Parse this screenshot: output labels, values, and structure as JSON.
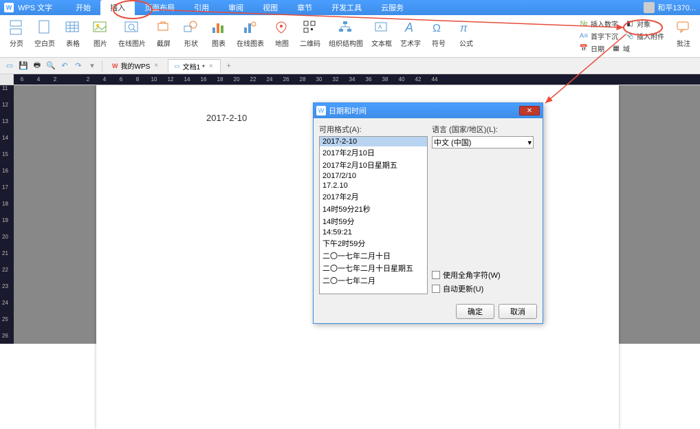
{
  "app_name": "WPS 文字",
  "user_name": "和平1370...",
  "menu_tabs": [
    "开始",
    "插入",
    "页面布局",
    "引用",
    "审阅",
    "视图",
    "章节",
    "开发工具",
    "云服务"
  ],
  "active_tab": "插入",
  "ribbon_tools": [
    {
      "label": "分页",
      "dropdown": true
    },
    {
      "label": "空白页",
      "dropdown": true
    },
    {
      "label": "表格",
      "dropdown": true
    },
    {
      "label": "图片",
      "dropdown": true
    },
    {
      "label": "在线图片"
    },
    {
      "label": "截屏",
      "dropdown": true
    },
    {
      "label": "形状",
      "dropdown": true
    },
    {
      "label": "图表"
    },
    {
      "label": "在线图表",
      "dropdown": true
    },
    {
      "label": "地图"
    },
    {
      "label": "二维码"
    },
    {
      "label": "组织结构图"
    },
    {
      "label": "文本框",
      "dropdown": true
    },
    {
      "label": "艺术字",
      "dropdown": true
    },
    {
      "label": "符号",
      "dropdown": true
    },
    {
      "label": "公式"
    }
  ],
  "ribbon_right": [
    {
      "label": "插入数字"
    },
    {
      "label": "对象",
      "dropdown": true
    },
    {
      "label": "首字下沉"
    },
    {
      "label": "插入附件"
    },
    {
      "label": "日期"
    },
    {
      "label": "域"
    }
  ],
  "ribbon_end": {
    "label": "批注"
  },
  "doc_tabs": [
    {
      "label": "我的WPS",
      "type": "wps"
    },
    {
      "label": "文档1 *",
      "type": "doc",
      "active": true
    }
  ],
  "ruler_marks": [
    "6",
    "4",
    "2",
    "",
    "2",
    "4",
    "6",
    "8",
    "10",
    "12",
    "14",
    "16",
    "18",
    "20",
    "22",
    "24",
    "26",
    "28",
    "30",
    "32",
    "34",
    "36",
    "38",
    "40",
    "42",
    "44"
  ],
  "vruler_marks": [
    "11",
    "12",
    "13",
    "14",
    "15",
    "16",
    "17",
    "18",
    "19",
    "20",
    "21",
    "22",
    "23",
    "24",
    "25",
    "26"
  ],
  "document_text": "2017-2-10",
  "dialog": {
    "title": "日期和时间",
    "format_label": "可用格式(A):",
    "lang_label": "语言 (国家/地区)(L):",
    "formats": [
      "2017-2-10",
      "2017年2月10日",
      "2017年2月10日星期五",
      "2017/2/10",
      "17.2.10",
      "2017年2月",
      "14时59分21秒",
      "14时59分",
      "14:59:21",
      "下午2时59分",
      "二〇一七年二月十日",
      "二〇一七年二月十日星期五",
      "二〇一七年二月"
    ],
    "selected_format": 0,
    "language": "中文 (中国)",
    "fullwidth_label": "使用全角字符(W)",
    "autoupdate_label": "自动更新(U)",
    "ok_label": "确定",
    "cancel_label": "取消"
  }
}
